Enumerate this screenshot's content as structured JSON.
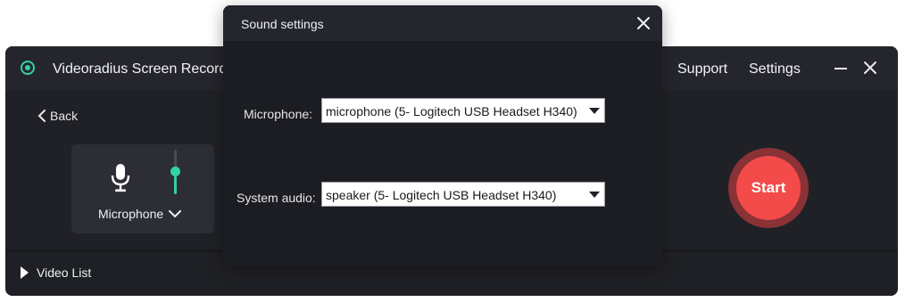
{
  "app": {
    "title": "Videoradius Screen Recorder",
    "nav": {
      "support": "Support",
      "settings": "Settings"
    },
    "colors": {
      "accent": "#33d1a4",
      "start": "#f24b49"
    }
  },
  "recorder": {
    "back_label": "Back",
    "source_label": "Microphone",
    "volume_level": 0.45,
    "start_label": "Start",
    "video_list_label": "Video List"
  },
  "dialog": {
    "title": "Sound settings",
    "microphone_label": "Microphone:",
    "microphone_value": "microphone (5- Logitech USB Headset H340)",
    "system_audio_label": "System audio:",
    "system_audio_value": "speaker (5- Logitech USB Headset H340)"
  }
}
